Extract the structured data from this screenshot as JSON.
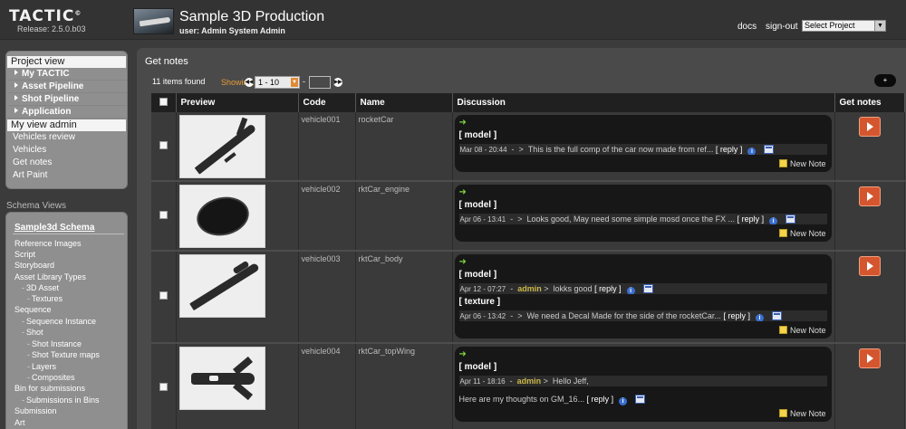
{
  "header": {
    "logo": "TACTIC",
    "logo_mark": "©",
    "release": "Release: 2.5.0.b03",
    "project_title": "Sample 3D Production",
    "user_line": "user: Admin System Admin",
    "docs": "docs",
    "signout": "sign-out",
    "project_select": "Select Project"
  },
  "sidebar": {
    "project_view": "Project view",
    "project_items": [
      {
        "label": "My TACTIC"
      },
      {
        "label": "Asset Pipeline"
      },
      {
        "label": "Shot Pipeline"
      },
      {
        "label": "Application"
      }
    ],
    "my_view": "My view admin",
    "my_view_links": [
      {
        "label": "Vehicles review"
      },
      {
        "label": "Vehicles"
      },
      {
        "label": "Get notes"
      },
      {
        "label": "Art Paint"
      }
    ],
    "schema_views_label": "Schema Views",
    "schema_title": "Sample3d Schema",
    "schema_items": [
      {
        "label": "Reference Images",
        "dash": ""
      },
      {
        "label": "Script",
        "dash": ""
      },
      {
        "label": "Storyboard",
        "dash": ""
      },
      {
        "label": "Asset Library Types",
        "dash": ""
      },
      {
        "label": "3D Asset",
        "dash": "-"
      },
      {
        "label": "Textures",
        "dash": "-"
      },
      {
        "label": "Sequence",
        "dash": ""
      },
      {
        "label": "Sequence Instance",
        "dash": "-"
      },
      {
        "label": "Shot",
        "dash": "-"
      },
      {
        "label": "Shot Instance",
        "dash": "-"
      },
      {
        "label": "Shot Texture maps",
        "dash": "-"
      },
      {
        "label": "Layers",
        "dash": "-"
      },
      {
        "label": "Composites",
        "dash": "-"
      },
      {
        "label": "Bin for submissions",
        "dash": ""
      },
      {
        "label": "Submissions in Bins",
        "dash": "-"
      },
      {
        "label": "Submission",
        "dash": ""
      },
      {
        "label": "Art",
        "dash": ""
      }
    ]
  },
  "main": {
    "title": "Get notes",
    "items_found": "11 items found",
    "showing": "Showing:",
    "page_range": "1 - 10",
    "page_dash": "-",
    "options": "+",
    "columns": {
      "preview": "Preview",
      "code": "Code",
      "name": "Name",
      "discussion": "Discussion",
      "get_notes": "Get notes"
    },
    "rows": [
      {
        "code": "vehicle001",
        "name": "rocketCar",
        "notes": [
          {
            "context": "[ model ]",
            "date": "Mar 08 - 20:44",
            "sep": "-",
            "author": "",
            "text": "This is the full comp of the car now made from ref...",
            "reply": "[ reply ]"
          }
        ],
        "new_note": "New Note"
      },
      {
        "code": "vehicle002",
        "name": "rktCar_engine",
        "notes": [
          {
            "context": "[ model ]",
            "date": "Apr 06 - 13:41",
            "sep": "-",
            "author": "",
            "text": "Looks good, May need some simple mosd once the FX ...",
            "reply": "[ reply ]"
          }
        ],
        "new_note": "New Note"
      },
      {
        "code": "vehicle003",
        "name": "rktCar_body",
        "notes": [
          {
            "context": "[ model ]",
            "date": "Apr 12 - 07:27",
            "sep": "-",
            "author": "admin",
            "text": "lokks good",
            "reply": "[ reply ]"
          },
          {
            "context": "[ texture ]",
            "date": "Apr 06 - 13:42",
            "sep": "-",
            "author": "",
            "text": "We need a Decal Made for the side of the rocketCar...",
            "reply": "[ reply ]"
          }
        ],
        "new_note": "New Note"
      },
      {
        "code": "vehicle004",
        "name": "rktCar_topWing",
        "notes": [
          {
            "context": "[ model ]",
            "date": "Apr 11 - 18:16",
            "sep": "-",
            "author": "admin",
            "text": "Hello Jeff,",
            "extra": "Here are my thoughts on GM_16...",
            "reply": "[ reply ]"
          }
        ],
        "new_note": "New Note"
      }
    ]
  }
}
